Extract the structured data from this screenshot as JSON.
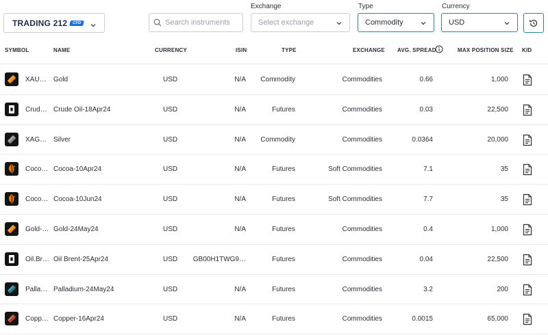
{
  "brand": {
    "logo_text": "TRADING 212",
    "badge": "CFD"
  },
  "search": {
    "placeholder": "Search instruments"
  },
  "filters": {
    "exchange": {
      "label": "Exchange",
      "placeholder": "Select exchange"
    },
    "type": {
      "label": "Type",
      "value": "Commodity"
    },
    "currency": {
      "label": "Currency",
      "value": "USD"
    }
  },
  "columns": {
    "symbol": "SYMBOL",
    "name": "NAME",
    "currency": "CURRENCY",
    "isin": "ISIN",
    "type": "TYPE",
    "exchange": "EXCHANGE",
    "spread": "AVG. SPREAD",
    "maxpos": "MAX POSITION SIZE",
    "kid": "KID"
  },
  "rows": [
    {
      "symbol": "XAUUS…",
      "name": "Gold",
      "currency": "USD",
      "isin": "N/A",
      "type": "Commodity",
      "exchange": "Commodities",
      "spread": "0.66",
      "maxpos": "1,000",
      "icon": "gold-bar-icon"
    },
    {
      "symbol": "Crude…",
      "name": "Crude Oil-18Apr24",
      "currency": "USD",
      "isin": "N/A",
      "type": "Futures",
      "exchange": "Commodities",
      "spread": "0.03",
      "maxpos": "22,500",
      "icon": "oil-barrel-icon"
    },
    {
      "symbol": "XAGU…",
      "name": "Silver",
      "currency": "USD",
      "isin": "N/A",
      "type": "Commodity",
      "exchange": "Commodities",
      "spread": "0.0364",
      "maxpos": "20,000",
      "icon": "silver-bar-icon"
    },
    {
      "symbol": "Coco…",
      "name": "Cocoa-10Apr24",
      "currency": "USD",
      "isin": "N/A",
      "type": "Futures",
      "exchange": "Soft Commodities",
      "spread": "7.1",
      "maxpos": "35",
      "icon": "cocoa-icon"
    },
    {
      "symbol": "Coco…",
      "name": "Cocoa-10Jun24",
      "currency": "USD",
      "isin": "N/A",
      "type": "Futures",
      "exchange": "Soft Commodities",
      "spread": "7.7",
      "maxpos": "35",
      "icon": "cocoa-icon"
    },
    {
      "symbol": "Gold-…",
      "name": "Gold-24May24",
      "currency": "USD",
      "isin": "N/A",
      "type": "Futures",
      "exchange": "Commodities",
      "spread": "0.4",
      "maxpos": "1,000",
      "icon": "gold-bar-icon"
    },
    {
      "symbol": "Oil.Bre…",
      "name": "Oil Brent-25Apr24",
      "currency": "USD",
      "isin": "GB00H1TWG9…",
      "type": "Futures",
      "exchange": "Commodities",
      "spread": "0.04",
      "maxpos": "22,500",
      "icon": "oil-barrel-icon"
    },
    {
      "symbol": "Pallad…",
      "name": "Palladium-24May24",
      "currency": "USD",
      "isin": "N/A",
      "type": "Futures",
      "exchange": "Commodities",
      "spread": "3.2",
      "maxpos": "200",
      "icon": "palladium-bar-icon"
    },
    {
      "symbol": "Copp…",
      "name": "Copper-16Apr24",
      "currency": "USD",
      "isin": "N/A",
      "type": "Futures",
      "exchange": "Commodities",
      "spread": "0.0015",
      "maxpos": "65,000",
      "icon": "copper-bar-icon"
    }
  ],
  "colors": {
    "accent": "#1e8a9e",
    "gold": "#f08a1c",
    "silver": "#8a8d93",
    "palladium": "#1f7f8e",
    "copper": "#b5432a",
    "cocoa": "#e07a18"
  }
}
